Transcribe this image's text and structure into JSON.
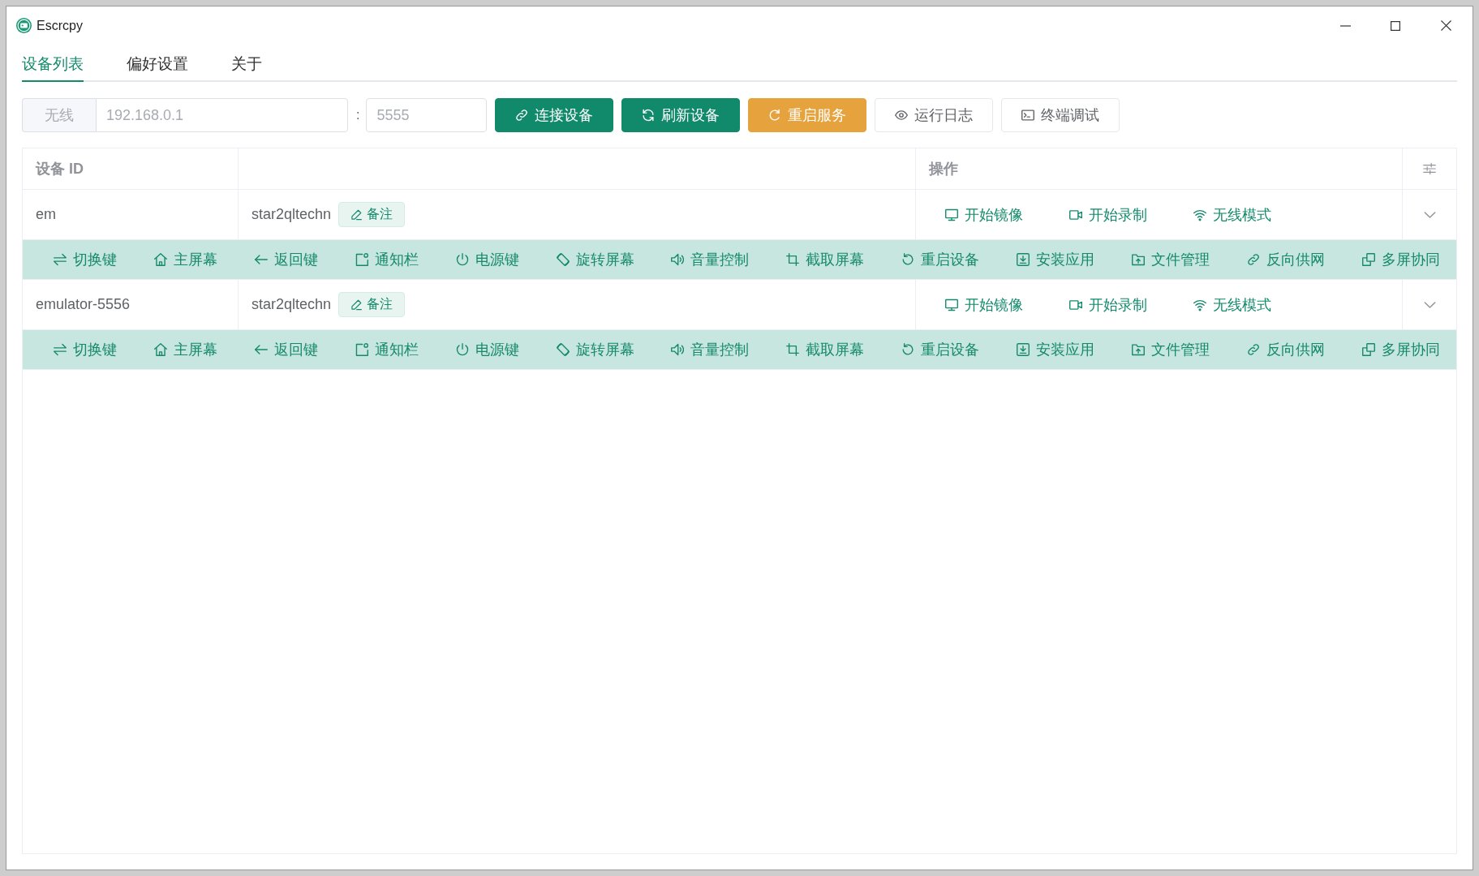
{
  "window": {
    "title": "Escrcpy"
  },
  "tabs": [
    {
      "label": "设备列表",
      "selected": true
    },
    {
      "label": "偏好设置",
      "selected": false
    },
    {
      "label": "关于",
      "selected": false
    }
  ],
  "toolbar": {
    "mode_label": "无线",
    "host_field": {
      "placeholder": "192.168.0.1"
    },
    "separator": ":",
    "port_field": {
      "placeholder": "5555"
    },
    "buttons": [
      {
        "label": "连接设备",
        "kind": "primary"
      },
      {
        "label": "刷新设备",
        "kind": "primary"
      },
      {
        "label": "重启服务",
        "kind": "warning"
      },
      {
        "label": "运行日志",
        "kind": "default"
      },
      {
        "label": "终端调试",
        "kind": "default"
      }
    ]
  },
  "table": {
    "header": {
      "device_id": "设备 ID",
      "actions": "操作"
    },
    "rows": [
      {
        "device_id": "em",
        "name": "star2qltechn",
        "remark": "备注",
        "actions": [
          "开始镜像",
          "开始录制",
          "无线模式"
        ],
        "expanded": true,
        "controls": [
          "切换键",
          "主屏幕",
          "返回键",
          "通知栏",
          "电源键",
          "旋转屏幕",
          "音量控制",
          "截取屏幕",
          "重启设备",
          "安装应用",
          "文件管理",
          "反向供网",
          "多屏协同"
        ]
      },
      {
        "device_id": "emulator-5556",
        "name": "star2qltechn",
        "remark": "备注",
        "actions": [
          "开始镜像",
          "开始录制",
          "无线模式"
        ],
        "expanded": true,
        "controls": [
          "切换键",
          "主屏幕",
          "返回键",
          "通知栏",
          "电源键",
          "旋转屏幕",
          "音量控制",
          "截取屏幕",
          "重启设备",
          "安装应用",
          "文件管理",
          "反向供网",
          "多屏协同"
        ]
      }
    ]
  }
}
